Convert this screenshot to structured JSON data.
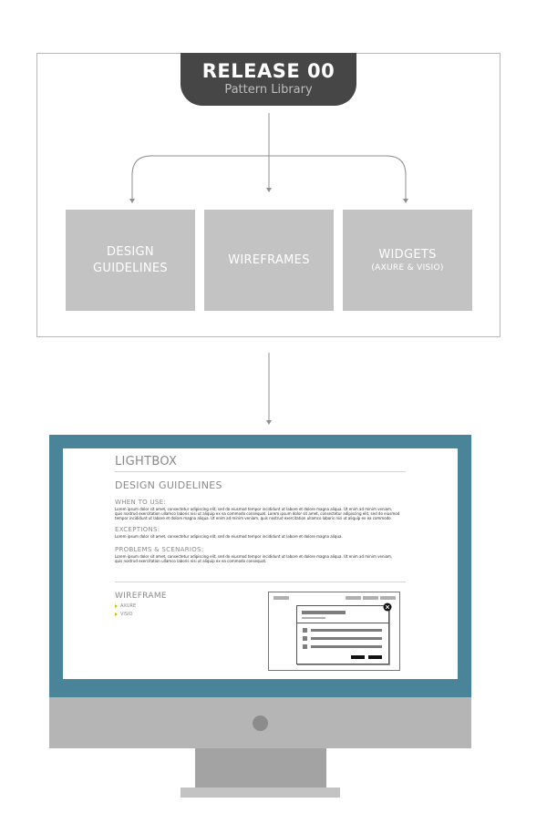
{
  "header": {
    "title": "RELEASE 00",
    "subtitle": "Pattern Library"
  },
  "boxes": [
    {
      "line1": "DESIGN",
      "line2": "GUIDELINES",
      "note": ""
    },
    {
      "line1": "WIREFRAMES",
      "line2": "",
      "note": ""
    },
    {
      "line1": "WIDGETS",
      "line2": "",
      "note": "(AXURE & VISIO)"
    }
  ],
  "screen": {
    "app_title": "LIGHTBOX",
    "section_title": "DESIGN GUIDELINES",
    "when_to_use": {
      "heading": "WHEN TO USE:",
      "body": "Lorem ipsum dolor sit amet, consectetur adipiscing elit, sed do eiusmod tempor incididunt ut labore et dolore magna aliqua. Ut enim ad minim veniam, quis nostrud exercitation ullamco laboris nisi ut aliquip ex ea commodo consequat. Lorem ipsum dolor sit amet, consectetur adipiscing elit, sed do eiusmod tempor incididunt ut labore et dolore magna aliqua. Ut enim ad minim veniam, quis nostrud exercitation ullamco laboris nisi ut aliquip ex ea commodo consequat."
    },
    "exceptions": {
      "heading": "EXCEPTIONS:",
      "body": "Lorem ipsum dolor sit amet, consectetur adipiscing elit, sed do eiusmod tempor incididunt ut labore et dolore magna aliqua."
    },
    "problems": {
      "heading": "PROBLEMS & SCENARIOS:",
      "body": "Lorem ipsum dolor sit amet, consectetur adipiscing elit, sed do eiusmod tempor incididunt ut labore et dolore magna aliqua. Ut enim ad minim veniam, quis nostrud exercitation ullamco laboris nisi ut aliquip ex ea commodo consequat."
    },
    "wireframe": {
      "heading": "WIREFRAME",
      "items": [
        "AXURE",
        "VISIO"
      ]
    }
  },
  "colors": {
    "header_bg": "#464646",
    "box_bg": "#c3c3c3",
    "bezel": "#4a8498",
    "accent": "#c2c700"
  }
}
